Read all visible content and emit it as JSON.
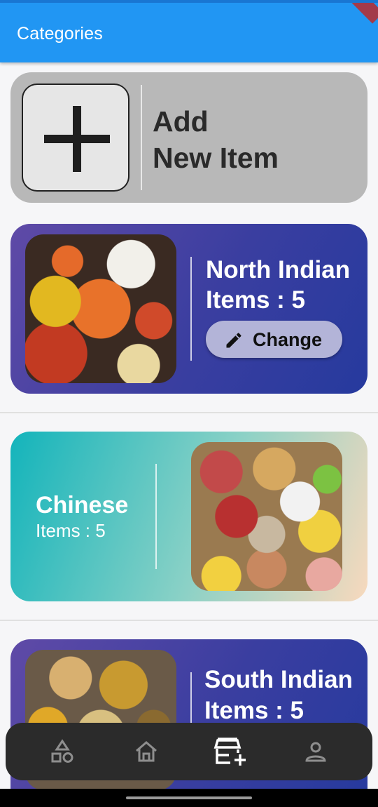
{
  "appbar": {
    "title": "Categories"
  },
  "add_card": {
    "line1": "Add",
    "line2": "New Item"
  },
  "categories": [
    {
      "name": "North Indian",
      "items": "Items : 5",
      "action": "Change"
    },
    {
      "name": "Chinese",
      "items": "Items : 5"
    },
    {
      "name": "South Indian",
      "items": "Items : 5"
    }
  ],
  "nav": {
    "items": [
      "shapes-icon",
      "home-icon",
      "add-store-icon",
      "profile-icon"
    ],
    "active": "add-store-icon"
  },
  "colors": {
    "appbar": "#2196f3",
    "purple_card": "#3a3ea0",
    "teal_card": "#13b4bb",
    "add_card": "#b8b8b8",
    "bottom_nav": "#2b2b2b"
  }
}
